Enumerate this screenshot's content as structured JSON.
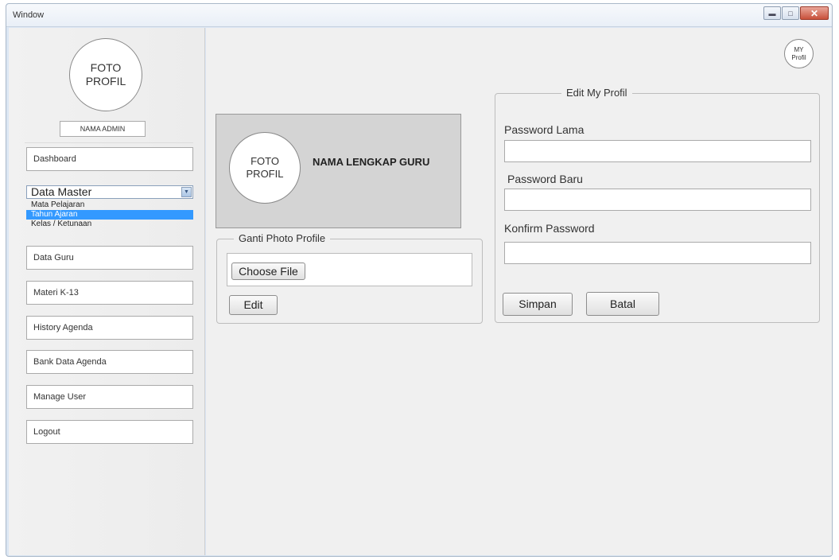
{
  "window": {
    "title": "Window"
  },
  "sidebar": {
    "avatar": {
      "line1": "FOTO",
      "line2": "PROFIL"
    },
    "admin_name": "NAMA ADMIN",
    "dashboard": "Dashboard",
    "data_master": {
      "selected": "Data Master",
      "options": [
        "Mata Pelajaran",
        "Tahun Ajaran",
        "Kelas / Ketunaan"
      ],
      "highlighted_index": 1
    },
    "items": [
      "Data Guru",
      "Materi K-13",
      "History Agenda",
      "Bank Data Agenda",
      "Manage User",
      "Logout"
    ]
  },
  "header": {
    "my_profil": {
      "line1": "MY",
      "line2": "Profil"
    }
  },
  "profile_card": {
    "avatar": {
      "line1": "FOTO",
      "line2": "PROFIL"
    },
    "full_name": "NAMA LENGKAP GURU"
  },
  "ganti_photo": {
    "legend": "Ganti Photo Profile",
    "choose_file": "Choose File",
    "edit": "Edit"
  },
  "edit_profil": {
    "legend": "Edit My Profil",
    "old_password_label": "Password Lama",
    "new_password_label": "Password Baru",
    "confirm_password_label": "Konfirm Password",
    "save": "Simpan",
    "cancel": "Batal"
  }
}
